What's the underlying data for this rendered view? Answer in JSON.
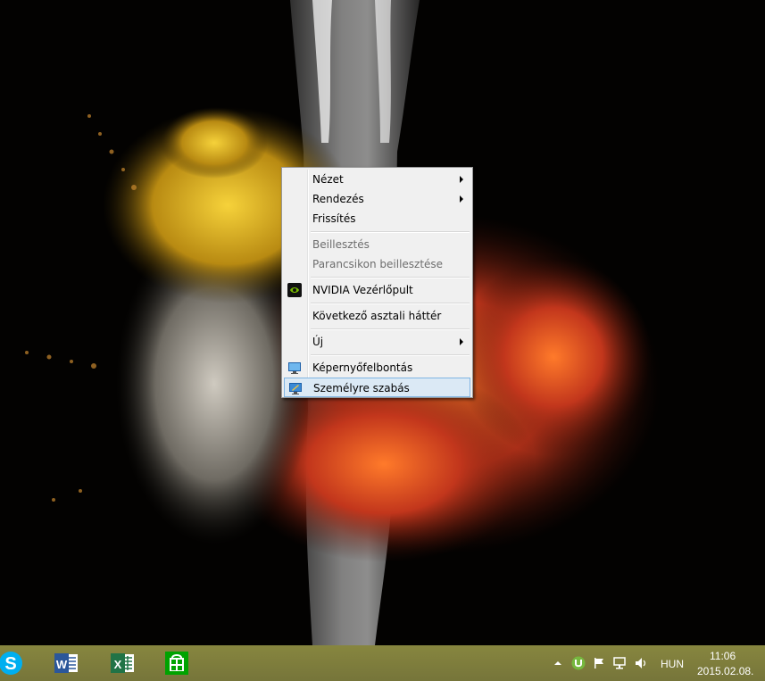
{
  "context_menu": {
    "items": [
      {
        "label": "Nézet"
      },
      {
        "label": "Rendezés"
      },
      {
        "label": "Frissítés"
      },
      {
        "label": "Beillesztés"
      },
      {
        "label": "Parancsikon beillesztése"
      },
      {
        "label": "NVIDIA Vezérlőpult"
      },
      {
        "label": "Következő asztali háttér"
      },
      {
        "label": "Új"
      },
      {
        "label": "Képernyőfelbontás"
      },
      {
        "label": "Személyre szabás"
      }
    ]
  },
  "taskbar": {
    "pinned_apps": [
      "skype-icon",
      "word-icon",
      "excel-icon",
      "store-icon"
    ],
    "word_glyph": "W",
    "excel_glyph": "X",
    "language": "HUN",
    "time": "11:06",
    "date": "2015.02.08."
  },
  "colors": {
    "taskbar": "#7c7b3d",
    "menu_bg": "#f0f0f0",
    "menu_highlight": "#dbe9f5",
    "menu_highlight_border": "#7fb4e3"
  }
}
